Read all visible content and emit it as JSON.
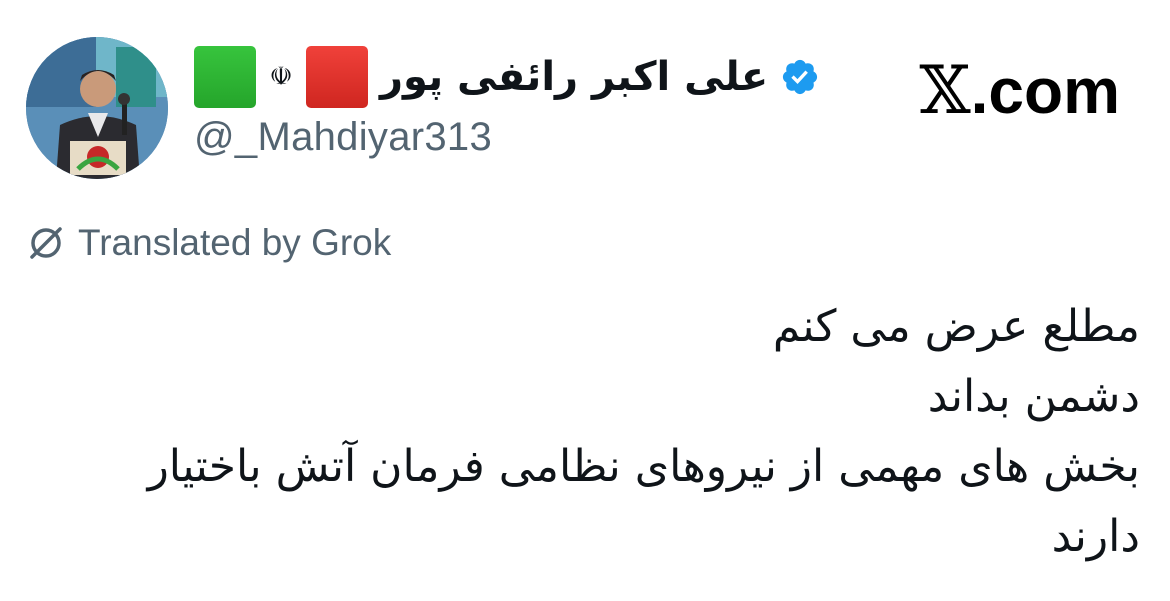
{
  "author": {
    "display_name": "علی اکبر رائفی پور",
    "handle": "@_Mahdiyar313",
    "verified_icon": "verified-badge-icon",
    "name_decorations": [
      "green-square-emoji",
      "iran-emblem",
      "red-square-emoji"
    ],
    "emblem_glyph": "☫"
  },
  "brand": {
    "x_glyph": "𝕏",
    "domain": ".com"
  },
  "translation": {
    "icon": "grok-icon",
    "label": "Translated by Grok"
  },
  "tweet": {
    "lines": [
      "مطلع عرض می کنم",
      "دشمن بداند",
      "بخش های مهمی از نیروهای نظامی فرمان آتش باختیار",
      "دارند"
    ]
  },
  "colors": {
    "text": "#0f1419",
    "secondary": "#536471",
    "verified_blue": "#1d9bf0",
    "flag_green": "#2fb835",
    "flag_red": "#e0332c"
  }
}
